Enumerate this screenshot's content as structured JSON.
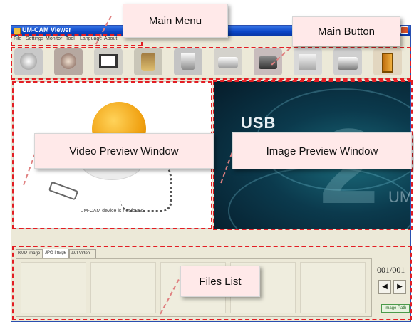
{
  "window": {
    "title": "UM-CAM Viewer"
  },
  "menu": [
    "File",
    "Settings",
    "Monitor",
    "Tool",
    "Language",
    "About"
  ],
  "toolbar_buttons": [
    {
      "icon": "camera-capture-icon"
    },
    {
      "icon": "camera-settings-icon"
    },
    {
      "icon": "film-icon"
    },
    {
      "icon": "tools-icon"
    },
    {
      "icon": "cup-icon"
    },
    {
      "icon": "projector-icon"
    },
    {
      "icon": "video-camera-icon"
    },
    {
      "icon": "display-icon"
    },
    {
      "icon": "printer-icon"
    },
    {
      "icon": "exit-door-icon"
    }
  ],
  "video_preview": {
    "message": "UM-CAM device is not found."
  },
  "image_preview": {
    "text_usb": "USB",
    "text_two": "2",
    "text_um": "UM"
  },
  "tabs": [
    "BMP Image",
    "JPG Image",
    "AVI Video"
  ],
  "pager": {
    "value": "001/001",
    "prev": "◀",
    "next": "▶",
    "image_path": "Image Path"
  },
  "annotations": {
    "main_menu": "Main Menu",
    "main_button": "Main Button",
    "video_preview": "Video Preview Window",
    "image_preview": "Image Preview Window",
    "files_list": "Files List"
  },
  "colors": {
    "annotation_border": "#e31e24",
    "callout_bg": "#ffe9e9",
    "titlebar": "#0a46c8"
  }
}
